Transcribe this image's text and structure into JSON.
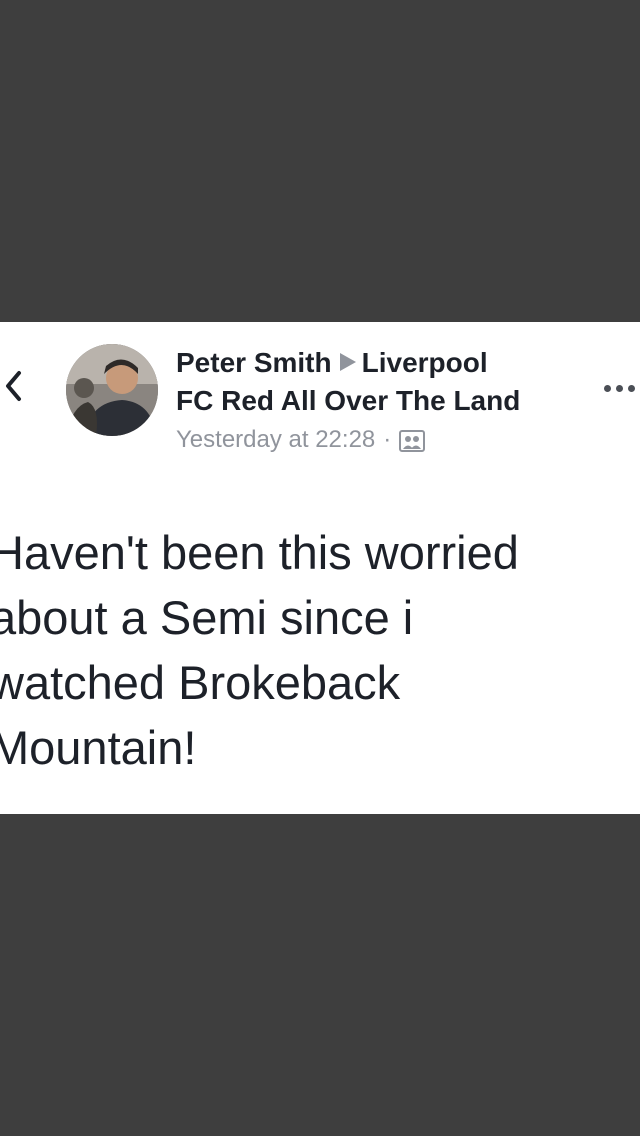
{
  "post": {
    "author": "Peter Smith",
    "group_line1": "Liverpool",
    "group_line2": "FC Red All Over The Land",
    "timestamp": "Yesterday at 22:28",
    "separator": "·",
    "privacy_icon": "group-icon",
    "text_lines": [
      "Haven't been this worried",
      "about a Semi since i",
      "watched Brokeback",
      "Mountain!"
    ]
  },
  "nav": {
    "back_icon": "chevron-left-icon",
    "more_icon": "more-options-icon"
  },
  "colors": {
    "background": "#3e3e3e",
    "card": "#ffffff",
    "text": "#1d2129",
    "meta": "#90949c"
  }
}
